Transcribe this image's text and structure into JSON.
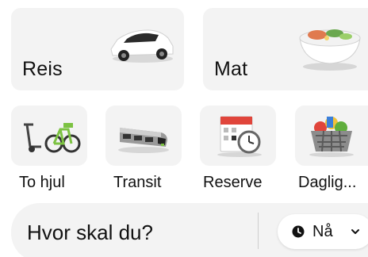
{
  "tiles": {
    "ride": {
      "label": "Reis",
      "icon": "car-icon"
    },
    "food": {
      "label": "Mat",
      "icon": "food-bowl-icon"
    }
  },
  "services": [
    {
      "label": "To hjul",
      "icon": "scooter-bike-icon"
    },
    {
      "label": "Transit",
      "icon": "train-icon"
    },
    {
      "label": "Reserve",
      "icon": "calendar-clock-icon"
    },
    {
      "label": "Daglig...",
      "icon": "grocery-basket-icon"
    }
  ],
  "search": {
    "prompt": "Hvor skal du?",
    "time_label": "Nå",
    "time_icon": "clock-icon",
    "dropdown_icon": "chevron-down-icon"
  }
}
